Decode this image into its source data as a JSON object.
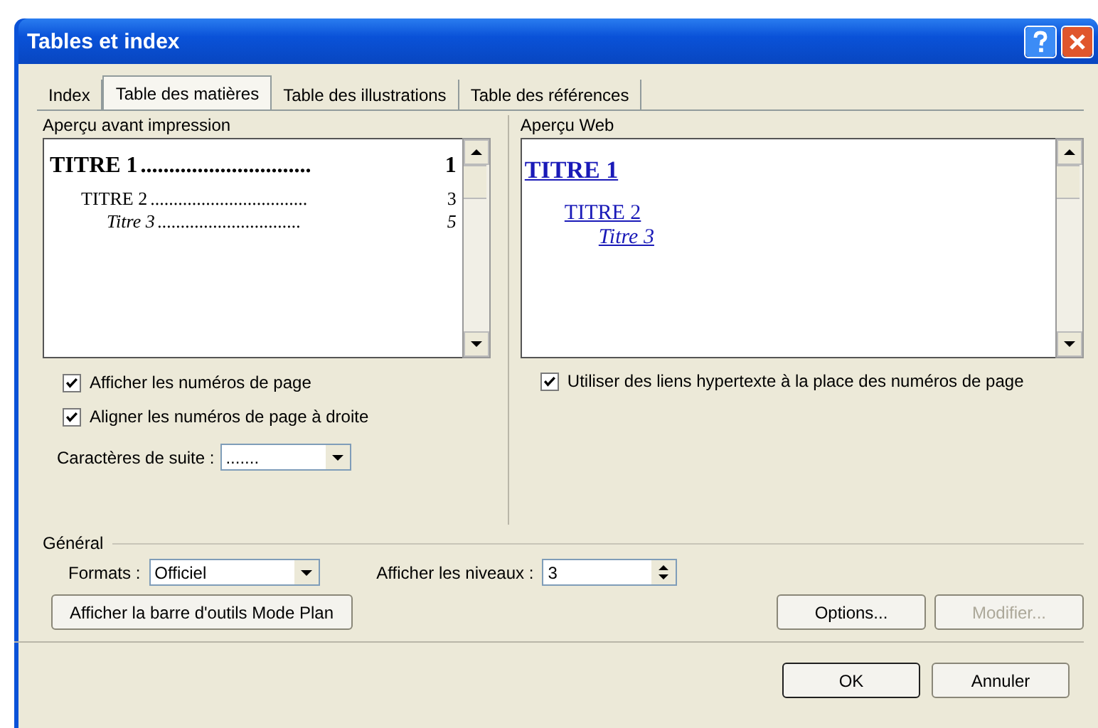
{
  "window": {
    "title": "Tables et index"
  },
  "tabs": [
    {
      "label": "Index",
      "selected": false
    },
    {
      "label": "Table des matières",
      "selected": true
    },
    {
      "label": "Table des illustrations",
      "selected": false
    },
    {
      "label": "Table des références",
      "selected": false
    }
  ],
  "print_preview": {
    "label": "Aperçu avant impression",
    "entries": [
      {
        "text": "TITRE 1",
        "leader": "..............................",
        "page": "1",
        "children": [
          {
            "text": "TITRE 2",
            "leader": "..................................",
            "page": "3",
            "children": [
              {
                "text": "Titre 3",
                "leader": "...............................",
                "page": "5"
              }
            ]
          }
        ]
      }
    ]
  },
  "web_preview": {
    "label": "Aperçu Web",
    "entries": [
      {
        "text": "TITRE 1",
        "children": [
          {
            "text": "TITRE 2",
            "children": [
              {
                "text": "Titre 3"
              }
            ]
          }
        ]
      }
    ]
  },
  "print_options": [
    {
      "label": "Afficher les numéros de page",
      "checked": true
    },
    {
      "label": "Aligner les numéros de page à droite",
      "checked": true
    }
  ],
  "web_options": [
    {
      "label": "Utiliser des liens hypertexte à la place des numéros de page",
      "checked": true
    }
  ],
  "tab_leader": {
    "label": "Caractères de suite :",
    "value": "......."
  },
  "general": {
    "label": "Général",
    "formats": {
      "label": "Formats :",
      "value": "Officiel"
    },
    "levels": {
      "label": "Afficher les niveaux :",
      "value": "3"
    }
  },
  "outline_button": {
    "label": "Afficher la barre d'outils Mode Plan"
  },
  "side_buttons": [
    {
      "label": "Options...",
      "disabled": false
    },
    {
      "label": "Modifier...",
      "disabled": true
    }
  ],
  "dialog_buttons": [
    {
      "label": "OK",
      "default": true
    },
    {
      "label": "Annuler",
      "default": false
    }
  ]
}
